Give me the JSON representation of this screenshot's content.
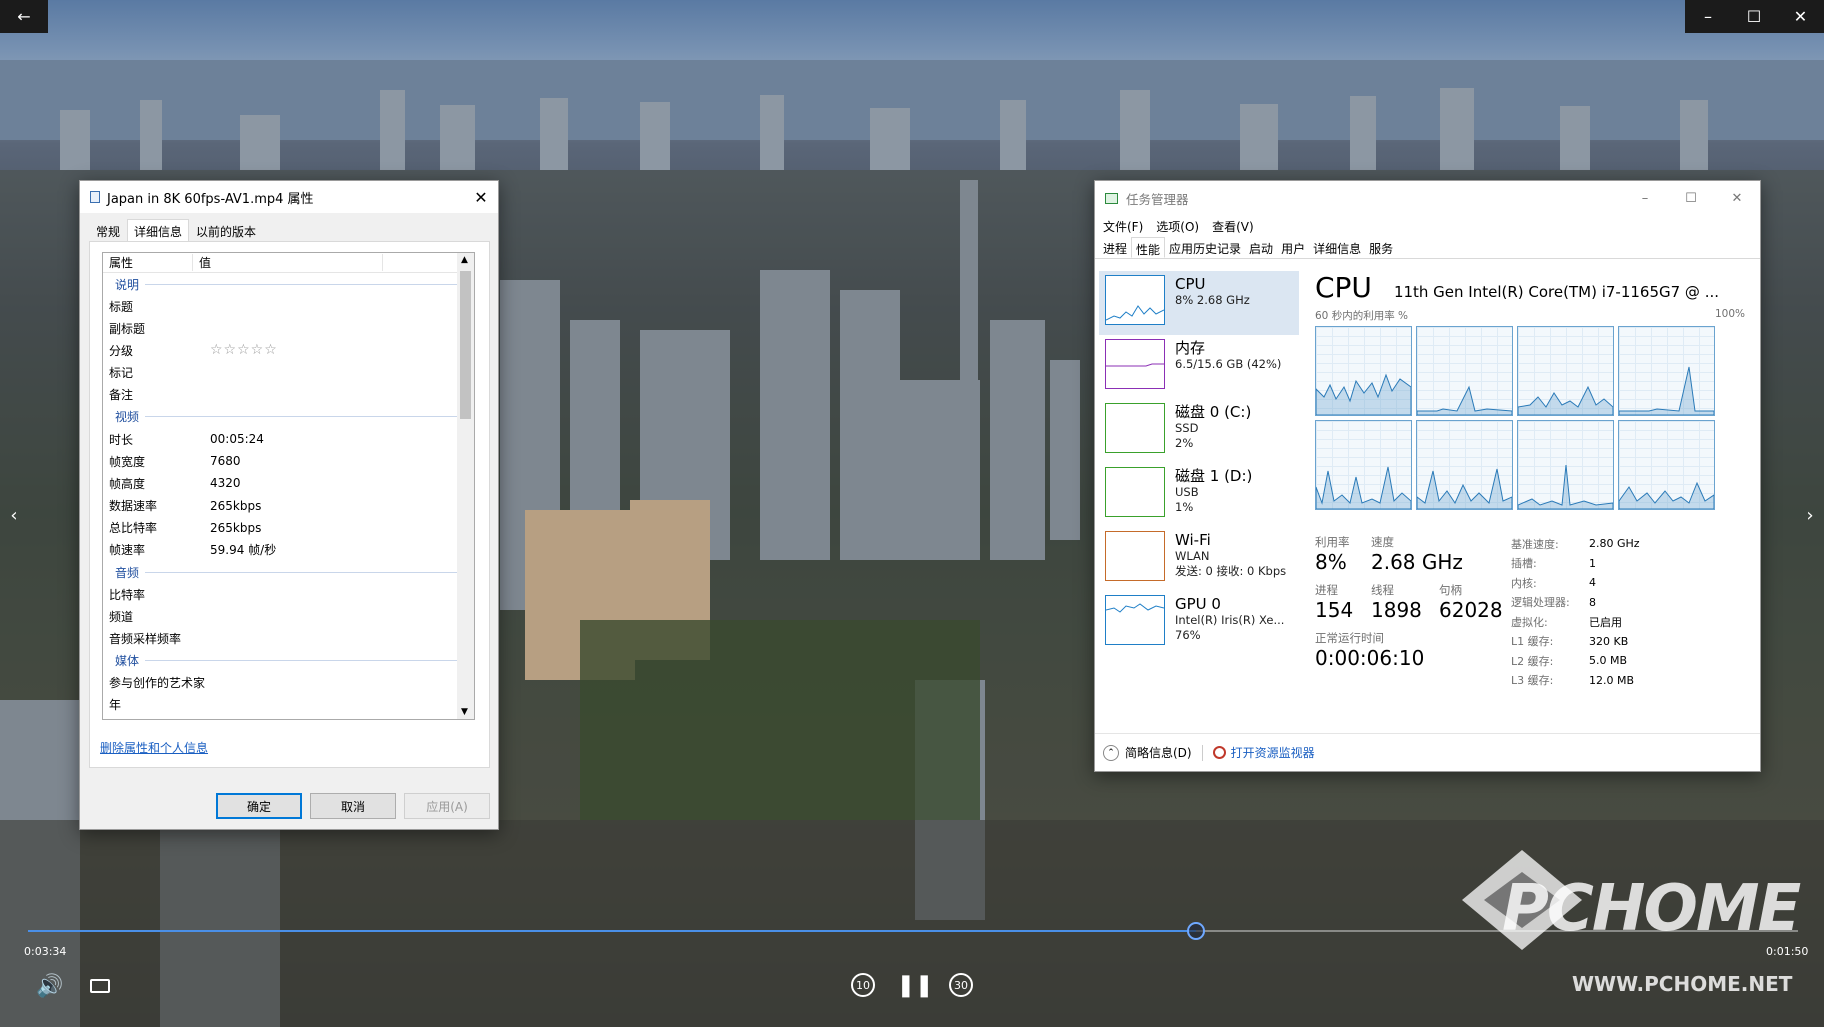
{
  "props": {
    "title": "Japan in 8K 60fps-AV1.mp4 属性",
    "tabs": [
      "常规",
      "详细信息",
      "以前的版本"
    ],
    "col_prop": "属性",
    "col_val": "值",
    "sections": {
      "desc": {
        "label": "说明",
        "rows": [
          [
            "标题",
            ""
          ],
          [
            "副标题",
            ""
          ],
          [
            "分级",
            "☆☆☆☆☆"
          ],
          [
            "标记",
            ""
          ],
          [
            "备注",
            ""
          ]
        ]
      },
      "video": {
        "label": "视频",
        "rows": [
          [
            "时长",
            "00:05:24"
          ],
          [
            "帧宽度",
            "7680"
          ],
          [
            "帧高度",
            "4320"
          ],
          [
            "数据速率",
            "265kbps"
          ],
          [
            "总比特率",
            "265kbps"
          ],
          [
            "帧速率",
            "59.94 帧/秒"
          ]
        ]
      },
      "audio": {
        "label": "音频",
        "rows": [
          [
            "比特率",
            ""
          ],
          [
            "频道",
            ""
          ],
          [
            "音频采样频率",
            ""
          ]
        ]
      },
      "media": {
        "label": "媒体",
        "rows": [
          [
            "参与创作的艺术家",
            ""
          ],
          [
            "年",
            ""
          ]
        ]
      }
    },
    "link": "删除属性和个人信息",
    "ok": "确定",
    "cancel": "取消",
    "apply": "应用(A)"
  },
  "tm": {
    "title": "任务管理器",
    "menu": [
      "文件(F)",
      "选项(O)",
      "查看(V)"
    ],
    "tabs": [
      "进程",
      "性能",
      "应用历史记录",
      "启动",
      "用户",
      "详细信息",
      "服务"
    ],
    "side": [
      {
        "name": "CPU",
        "l1": "8% 2.68 GHz",
        "l2": "",
        "l3": "",
        "color": "#1f7fc7"
      },
      {
        "name": "内存",
        "l1": "6.5/15.6 GB (42%)",
        "l2": "",
        "l3": "",
        "color": "#8b2fb5"
      },
      {
        "name": "磁盘 0 (C:)",
        "l1": "SSD",
        "l2": "2%",
        "l3": "",
        "color": "#3aa12c"
      },
      {
        "name": "磁盘 1 (D:)",
        "l1": "USB",
        "l2": "1%",
        "l3": "",
        "color": "#3aa12c"
      },
      {
        "name": "Wi-Fi",
        "l1": "WLAN",
        "l2": "发送: 0 接收: 0 Kbps",
        "l3": "",
        "color": "#c56b2a"
      },
      {
        "name": "GPU 0",
        "l1": "Intel(R) Iris(R) Xe...",
        "l2": "76%",
        "l3": "",
        "color": "#1f7fc7"
      }
    ],
    "heading": "CPU",
    "model": "11th Gen Intel(R) Core(TM) i7-1165G7 @ ...",
    "graph_label": "60 秒内的利用率 %",
    "graph_max": "100%",
    "util_lbl": "利用率",
    "util": "8%",
    "speed_lbl": "速度",
    "speed": "2.68 GHz",
    "proc_lbl": "进程",
    "proc": "154",
    "thr_lbl": "线程",
    "thr": "1898",
    "hnd_lbl": "句柄",
    "hnd": "62028",
    "up_lbl": "正常运行时间",
    "up": "0:00:06:10",
    "right": [
      [
        "基准速度:",
        "2.80 GHz"
      ],
      [
        "插槽:",
        "1"
      ],
      [
        "内核:",
        "4"
      ],
      [
        "逻辑处理器:",
        "8"
      ],
      [
        "虚拟化:",
        "已启用"
      ],
      [
        "L1 缓存:",
        "320 KB"
      ],
      [
        "L2 缓存:",
        "5.0 MB"
      ],
      [
        "L3 缓存:",
        "12.0 MB"
      ]
    ],
    "footer_left": "简略信息(D)",
    "footer_link": "打开资源监视器"
  },
  "player": {
    "elapsed": "0:03:34",
    "remaining": "0:01:50",
    "progress": 0.66,
    "skip_back": "10",
    "skip_fwd": "30"
  },
  "watermark": {
    "logo": "PCHOME",
    "url": "WWW.PCHOME.NET"
  }
}
